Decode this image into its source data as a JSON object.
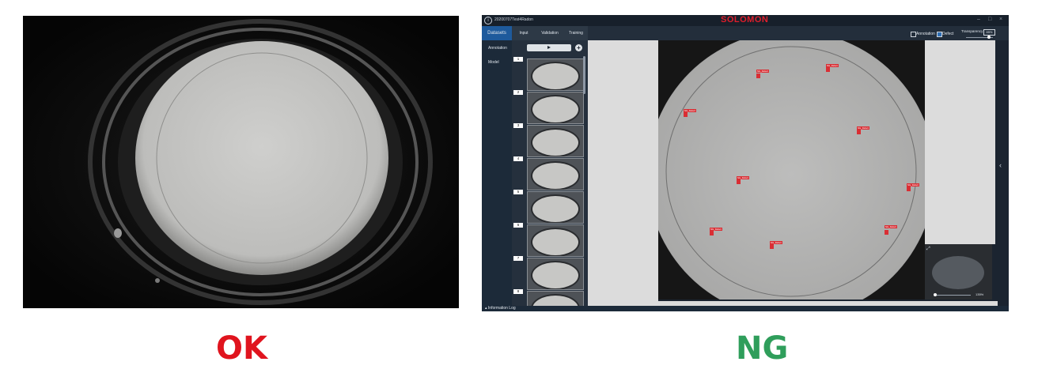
{
  "captions": {
    "ok": "OK",
    "ng": "NG"
  },
  "colors": {
    "ok": "#e0141e",
    "ng": "#2f9e5b",
    "brand": "#e01d2b",
    "defect": "#d92e34",
    "active_tab": "#1e5a9c"
  },
  "app": {
    "window_title": "20200707Test4Radon",
    "brand": "SOLOMON",
    "tabs": [
      {
        "label": "Datasets",
        "active": true
      },
      {
        "label": "Input"
      },
      {
        "label": "Validation"
      },
      {
        "label": "Training"
      }
    ],
    "sidebar": [
      "Annotation",
      "Model"
    ],
    "toggles": {
      "annotation": "Annotation",
      "defect": "Defect"
    },
    "transparency": {
      "label": "Transparency",
      "value": "85%"
    },
    "thumbnails": [
      "1",
      "2",
      "3",
      "4",
      "5",
      "6",
      "7",
      "8"
    ],
    "minimap_zoom": "135%",
    "info_log": "Information Log",
    "icons": [
      "info-icon",
      "minimize-icon",
      "maximize-icon",
      "close-icon",
      "play-icon",
      "plus-icon",
      "expand-icon",
      "chevron-left-icon",
      "chevron-up-icon"
    ]
  }
}
